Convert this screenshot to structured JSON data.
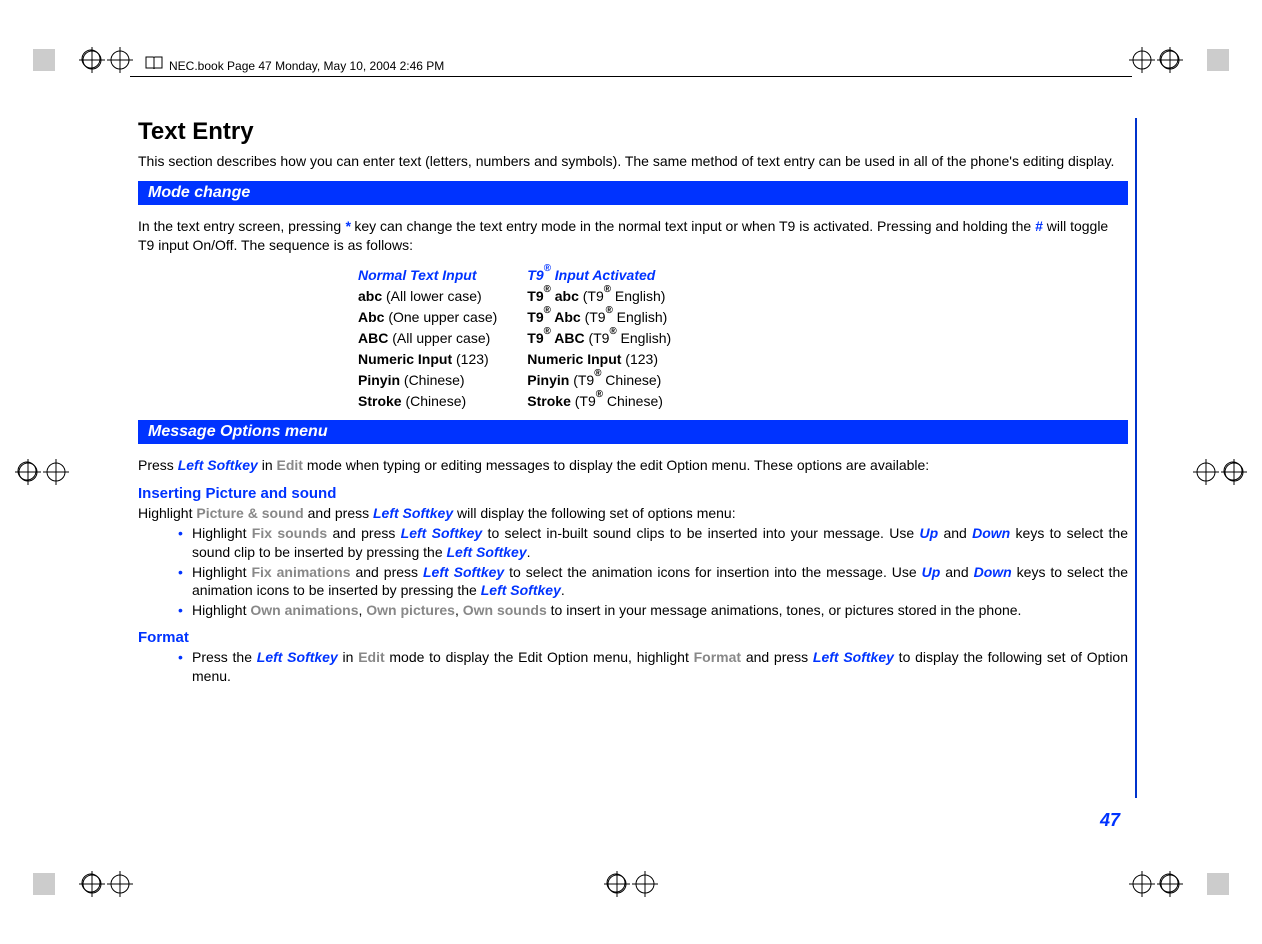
{
  "header": "NEC.book  Page 47  Monday, May 10, 2004  2:46 PM",
  "title": "Text Entry",
  "intro": "This section describes how you can enter text (letters, numbers and symbols). The same method of text entry can be used in all of the phone's editing display.",
  "section1": "Mode change",
  "mode_text_a": "In the text entry screen, pressing ",
  "mode_text_star": "*",
  "mode_text_b": " key can change the text entry mode in the normal text input or when T9 is activated. Pressing and holding the ",
  "mode_text_hash": "#",
  "mode_text_c": " will toggle T9 input On/Off. The sequence is as follows:",
  "col1": {
    "head": "Normal Text Input",
    "l1a": "abc",
    "l1b": " (All lower case)",
    "l2a": "Abc",
    "l2b": " (One upper case)",
    "l3a": "ABC",
    "l3b": " (All upper case)",
    "l4a": "Numeric Input",
    "l4b": " (123)",
    "l5a": "Pinyin",
    "l5b": " (Chinese)",
    "l6a": "Stroke",
    "l6b": " (Chinese)"
  },
  "col2": {
    "head_a": "T9",
    "head_b": " Input Activated",
    "l1a": "T9",
    "l1b": " abc",
    "l1c": " (T9",
    "l1d": " English)",
    "l2a": "T9",
    "l2b": " Abc",
    "l2c": " (T9",
    "l2d": " English)",
    "l3a": "T9",
    "l3b": " ABC",
    "l3c": " (T9",
    "l3d": " English)",
    "l4a": "Numeric Input",
    "l4b": " (123)",
    "l5a": "Pinyin",
    "l5b": " (T9",
    "l5c": " Chinese)",
    "l6a": "Stroke",
    "l6b": " (T9",
    "l6c": " Chinese)"
  },
  "section2": "Message Options menu",
  "msg_a": "Press ",
  "msg_ls": "Left Softkey",
  "msg_b": " in ",
  "msg_edit": "Edit",
  "msg_c": " mode when typing or editing messages to display the edit Option menu. These options are available:",
  "sub1": "Inserting Picture and sound",
  "ins_a": "Highlight ",
  "ins_ps": "Picture & sound",
  "ins_b": " and press ",
  "ins_c": " will display the following set of options menu:",
  "b1": {
    "a": "Highlight ",
    "fs": "Fix sounds",
    "b": " and press ",
    "c": " to select in-built sound clips to be inserted into your message. Use ",
    "up": "Up",
    "d": " and ",
    "down": "Down",
    "e": " keys to select the sound clip to be inserted by pressing the ",
    "f": "."
  },
  "b2": {
    "a": "Highlight ",
    "fa": "Fix animations",
    "b": " and press ",
    "c": " to select the animation icons for insertion into the message. Use ",
    "d": " and ",
    "e": " keys to select the animation icons to be inserted by pressing the ",
    "f": "."
  },
  "b3": {
    "a": "Highlight ",
    "oa": "Own animations",
    "c1": ", ",
    "op": "Own pictures",
    "c2": ", ",
    "os": "Own sounds",
    "b": "  to insert in your message animations, tones, or pictures stored in the phone."
  },
  "sub2": "Format",
  "fmt": {
    "a": "Press the ",
    "b": " in ",
    "c": " mode to display the Edit Option menu, highlight  ",
    "format": "Format",
    "d": " and press ",
    "e": " to display the following set of Option menu."
  },
  "page_num": "47",
  "reg_sup": "®"
}
